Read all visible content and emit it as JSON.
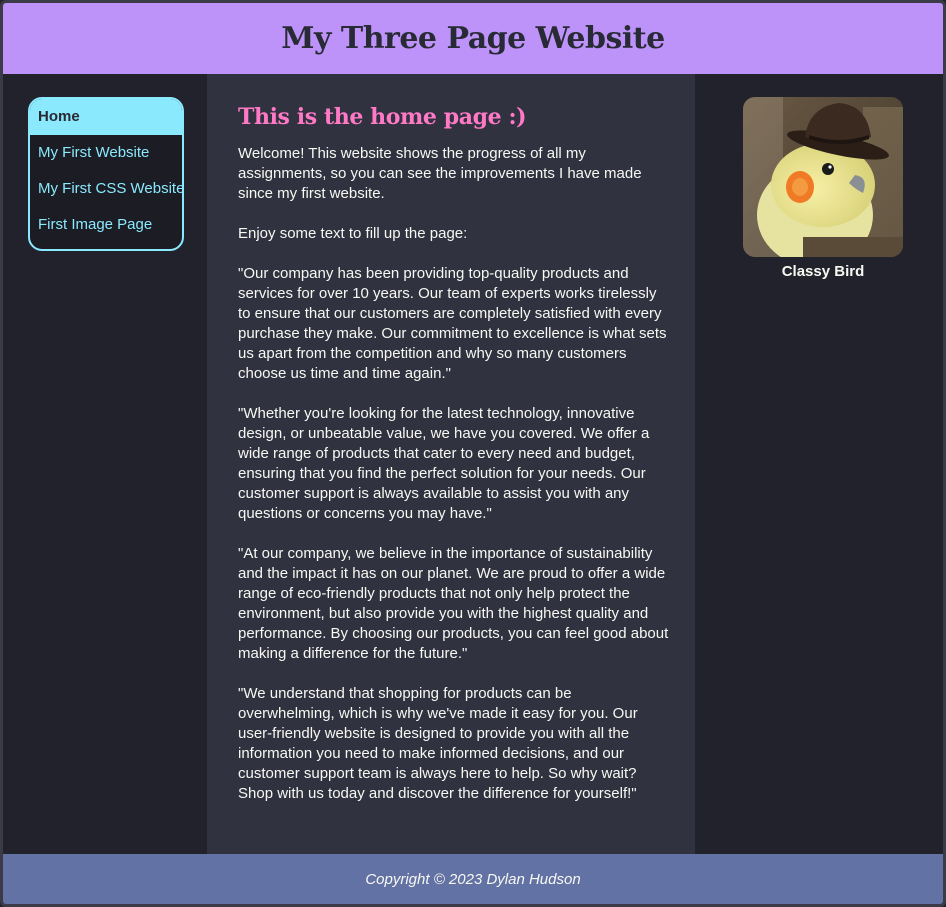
{
  "header": {
    "title": "My Three Page Website"
  },
  "nav": {
    "items": [
      {
        "label": "Home",
        "active": true
      },
      {
        "label": "My First Website",
        "active": false
      },
      {
        "label": "My First CSS Website",
        "active": false
      },
      {
        "label": "First Image Page",
        "active": false
      }
    ]
  },
  "main": {
    "heading": "This is the home page :)",
    "paragraphs": [
      "Welcome! This website shows the progress of all my assignments, so you can see the improvements I have made since my first website.",
      "Enjoy some text to fill up the page:",
      "\"Our company has been providing top-quality products and services for over 10 years. Our team of experts works tirelessly to ensure that our customers are completely satisfied with every purchase they make. Our commitment to excellence is what sets us apart from the competition and why so many customers choose us time and time again.\"",
      "\"Whether you're looking for the latest technology, innovative design, or unbeatable value, we have you covered. We offer a wide range of products that cater to every need and budget, ensuring that you find the perfect solution for your needs. Our customer support is always available to assist you with any questions or concerns you may have.\"",
      "\"At our company, we believe in the importance of sustainability and the impact it has on our planet. We are proud to offer a wide range of eco-friendly products that not only help protect the environment, but also provide you with the highest quality and performance. By choosing our products, you can feel good about making a difference for the future.\"",
      "\"We understand that shopping for products can be overwhelming, which is why we've made it easy for you. Our user-friendly website is designed to provide you with all the information you need to make informed decisions, and our customer support team is always here to help. So why wait? Shop with us today and discover the difference for yourself!\""
    ]
  },
  "aside": {
    "caption": "Classy Bird"
  },
  "footer": {
    "copyright": "Copyright © 2023 Dylan Hudson"
  },
  "colors": {
    "header_bg": "#bd93f9",
    "nav_accent": "#8be9fd",
    "heading_pink": "#ff79c6",
    "footer_bg": "#6272a4",
    "page_bg": "#21222c",
    "main_bg": "#303240"
  }
}
